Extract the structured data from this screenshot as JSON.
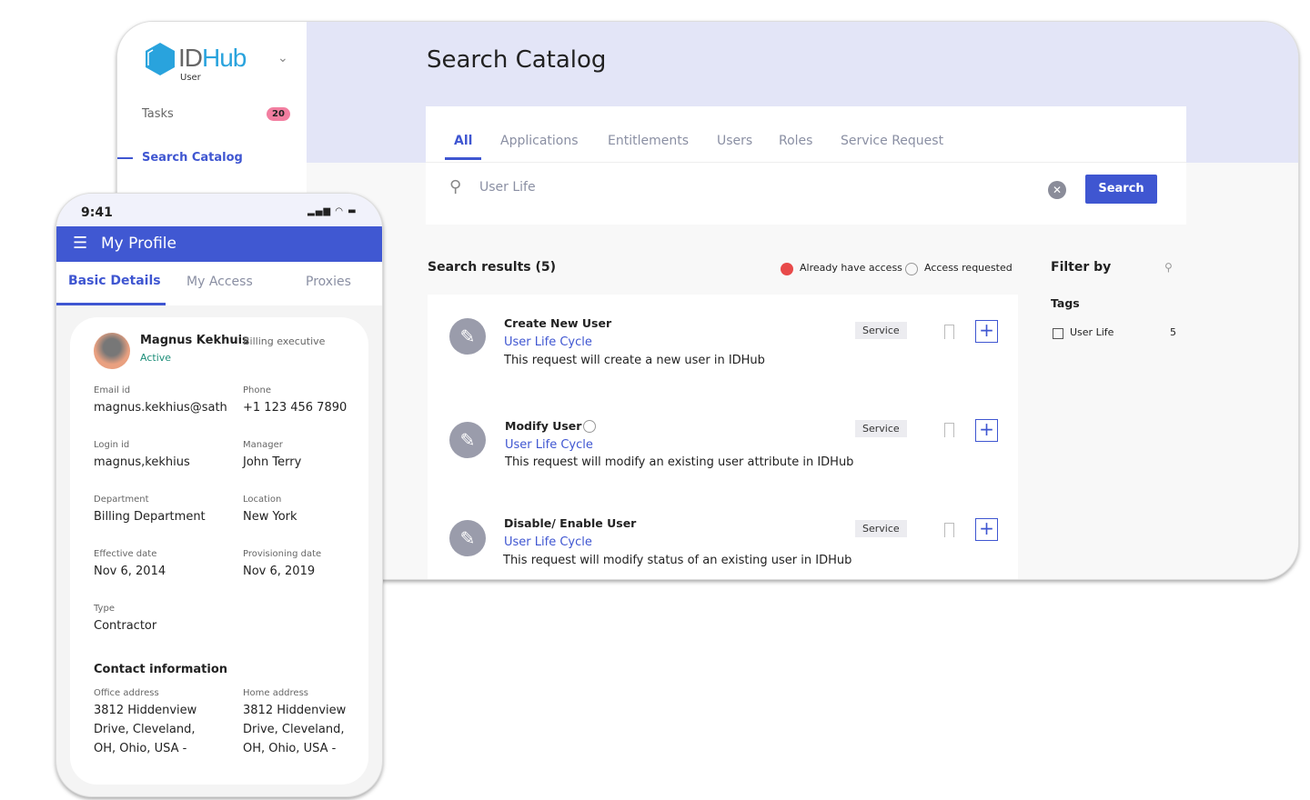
{
  "app": {
    "logo": "ID",
    "logo_accent": "Hub",
    "role": "User"
  },
  "sidebar": {
    "items": [
      {
        "label": "Tasks",
        "badge": "20"
      },
      {
        "label": "Search Catalog",
        "active": true
      }
    ]
  },
  "page": {
    "title": "Search Catalog"
  },
  "tabs": [
    "All",
    "Applications",
    "Entitlements",
    "Users",
    "Roles",
    "Service Request"
  ],
  "search": {
    "value": "User Life",
    "button": "Search"
  },
  "results": {
    "heading": "Search results (5)",
    "legend": [
      "Already have access",
      "Access requested"
    ],
    "items": [
      {
        "title": "Create New  User",
        "category": "User Life Cycle",
        "description": "This request will create a new user in IDHub",
        "type": "Service"
      },
      {
        "title": "Modify User",
        "category": "User Life Cycle",
        "description": "This request will modify an existing user attribute in IDHub",
        "type": "Service",
        "requested": true
      },
      {
        "title": "Disable/ Enable User",
        "category": "User Life Cycle",
        "description": "This request will modify status of an existing user in IDHub",
        "type": "Service"
      }
    ]
  },
  "filter": {
    "title": "Filter by",
    "section": "Tags",
    "tags": [
      {
        "label": "User Life",
        "count": "5"
      }
    ]
  },
  "colors": {
    "accent": "#3f56d1",
    "badge": "#f27ea0",
    "band": "#e3e5f7",
    "active": "#1f8f7a"
  },
  "phone": {
    "time": "9:41",
    "title": "My Profile",
    "tabs": [
      "Basic Details",
      "My Access",
      "Proxies"
    ],
    "profile": {
      "name": "Magnus Kekhuis",
      "role": "Billing executive",
      "status": "Active"
    },
    "fields": [
      {
        "label": "Email id",
        "value": "magnus.kekhius@sath"
      },
      {
        "label": "Phone",
        "value": "+1 123 456 7890"
      },
      {
        "label": "Login id",
        "value": "magnus,kekhius"
      },
      {
        "label": "Manager",
        "value": "John Terry"
      },
      {
        "label": "Department",
        "value": "Billing Department"
      },
      {
        "label": "Location",
        "value": "New York"
      },
      {
        "label": "Effective date",
        "value": "Nov 6, 2014"
      },
      {
        "label": "Provisioning date",
        "value": "Nov 6, 2019"
      },
      {
        "label": "Type",
        "value": "Contractor"
      }
    ],
    "contact": {
      "title": "Contact information",
      "office_label": "Office address",
      "office": "3812 Hiddenview Drive, Cleveland, OH, Ohio, USA -",
      "home_label": "Home address",
      "home": "3812 Hiddenview Drive, Cleveland, OH, Ohio, USA -"
    }
  }
}
